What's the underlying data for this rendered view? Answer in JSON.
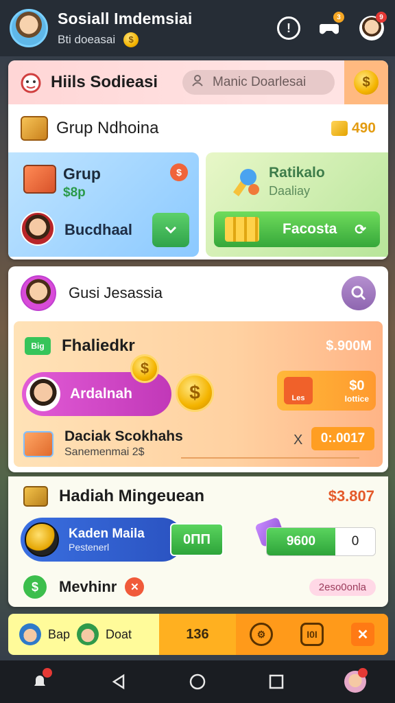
{
  "header": {
    "title": "Sosiall Imdemsiai",
    "subtitle": "Bti doeasai",
    "badges": [
      "3",
      "9"
    ]
  },
  "card1": {
    "title": "Hiils Sodieasi",
    "search_placeholder": "Manic Doarlesai",
    "group_label": "Grup Ndhoina",
    "group_amount": "490",
    "panelA": {
      "title": "Grup",
      "sub": "$8p",
      "badge": "$",
      "name": "Bucdhaal",
      "button_icon": "chevron-down-icon"
    },
    "panelB": {
      "title": "Ratikalo",
      "sub": "Daaliay",
      "button_label": "Facosta"
    }
  },
  "card2": {
    "title": "Gusi Jesassia",
    "row1_label": "Fhaliedkr",
    "row1_amount": "$.900M",
    "cash_icon_text": "Big",
    "pink_label": "Ardalnah",
    "coin_symbol": "$",
    "orange_icon_text": "Les",
    "orange_value": "$0",
    "orange_sub": "Iottice",
    "row3_label": "Daciak Scokhahs",
    "row3_sub": "Sanemenmai 2$",
    "row3_x": "X",
    "timer": "0:.0017"
  },
  "card3": {
    "title": "Hadiah Mingeuean",
    "amount": "$3.807",
    "blue_title": "Kaden Maila",
    "blue_sub": "Pestenerl",
    "green_btn": "0ΠΠ",
    "stepper_value": "9600",
    "stepper_count": "0",
    "bottom_label": "Mevhinr",
    "bottom_tag": "2eso0onla"
  },
  "actionbar": {
    "left_a": "Bap",
    "left_b": "Doat",
    "mid": "136",
    "icon2_text": "I0I",
    "close": "✕"
  },
  "colors": {
    "accent": "#ff9a1a",
    "green": "#36a83a",
    "pink": "#c138b8",
    "blue": "#2a52c0"
  }
}
